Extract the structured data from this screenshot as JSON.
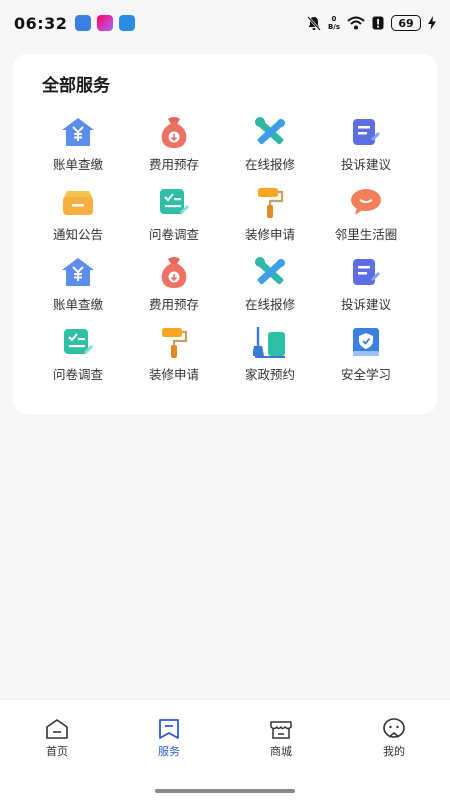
{
  "status": {
    "time": "06:32",
    "net_speed_top": "0",
    "net_speed_unit": "B/s",
    "battery": "69"
  },
  "card": {
    "title": "全部服务",
    "services": [
      {
        "label": "账单查缴",
        "icon": "bill-house-icon"
      },
      {
        "label": "费用预存",
        "icon": "money-bag-icon"
      },
      {
        "label": "在线报修",
        "icon": "tools-icon"
      },
      {
        "label": "投诉建议",
        "icon": "edit-note-icon"
      },
      {
        "label": "通知公告",
        "icon": "notice-box-icon"
      },
      {
        "label": "问卷调查",
        "icon": "clipboard-check-icon"
      },
      {
        "label": "装修申请",
        "icon": "paint-roller-icon"
      },
      {
        "label": "邻里生活圈",
        "icon": "chat-bubble-icon"
      },
      {
        "label": "账单查缴",
        "icon": "bill-house-icon"
      },
      {
        "label": "费用预存",
        "icon": "money-bag-icon"
      },
      {
        "label": "在线报修",
        "icon": "tools-icon"
      },
      {
        "label": "投诉建议",
        "icon": "edit-note-icon"
      },
      {
        "label": "问卷调查",
        "icon": "clipboard-check-icon"
      },
      {
        "label": "装修申请",
        "icon": "paint-roller-icon"
      },
      {
        "label": "家政预约",
        "icon": "broom-icon"
      },
      {
        "label": "安全学习",
        "icon": "shield-book-icon"
      }
    ]
  },
  "nav": {
    "items": [
      {
        "label": "首页",
        "icon": "home-icon",
        "active": false
      },
      {
        "label": "服务",
        "icon": "service-icon",
        "active": true
      },
      {
        "label": "商城",
        "icon": "store-icon",
        "active": false
      },
      {
        "label": "我的",
        "icon": "profile-icon",
        "active": false
      }
    ],
    "active_color": "#2b5bd6"
  }
}
